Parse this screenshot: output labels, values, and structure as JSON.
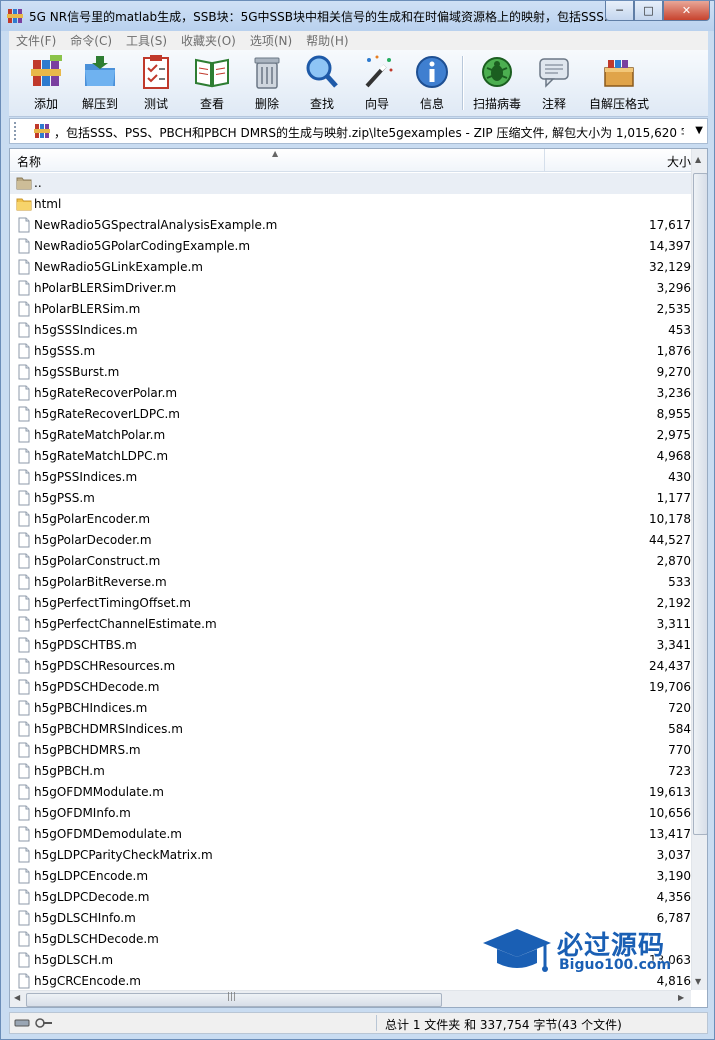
{
  "window": {
    "title": "5G NR信号里的matlab生成，SSB块：5G中SSB块中相关信号的生成和在时偏域资源格上的映射，包括SSS..."
  },
  "menu": [
    "文件(F)",
    "命令(C)",
    "工具(S)",
    "收藏夹(O)",
    "选项(N)",
    "帮助(H)"
  ],
  "toolbar": {
    "items": [
      {
        "label": "添加",
        "icon": "add-archive-icon"
      },
      {
        "label": "解压到",
        "icon": "extract-to-icon"
      },
      {
        "label": "测试",
        "icon": "test-icon"
      },
      {
        "label": "查看",
        "icon": "view-icon"
      },
      {
        "label": "删除",
        "icon": "delete-icon"
      },
      {
        "label": "查找",
        "icon": "find-icon"
      },
      {
        "label": "向导",
        "icon": "wizard-icon"
      },
      {
        "label": "信息",
        "icon": "info-icon"
      },
      {
        "label": "扫描病毒",
        "icon": "virus-scan-icon"
      },
      {
        "label": "注释",
        "icon": "comment-icon"
      },
      {
        "label": "自解压格式",
        "icon": "sfx-icon"
      }
    ]
  },
  "address": {
    "path": "，包括SSS、PSS、PBCH和PBCH DMRS的生成与映射.zip\\lte5gexamples - ZIP 压缩文件, 解包大小为 1,015,620 字节"
  },
  "columns": {
    "name": "名称",
    "size": "大小"
  },
  "files": [
    {
      "name": "..",
      "size": "",
      "type": "parent"
    },
    {
      "name": "html",
      "size": "",
      "type": "folder"
    },
    {
      "name": "NewRadio5GSpectralAnalysisExample.m",
      "size": "17,617",
      "type": "file"
    },
    {
      "name": "NewRadio5GPolarCodingExample.m",
      "size": "14,397",
      "type": "file"
    },
    {
      "name": "NewRadio5GLinkExample.m",
      "size": "32,129",
      "type": "file"
    },
    {
      "name": "hPolarBLERSimDriver.m",
      "size": "3,296",
      "type": "file"
    },
    {
      "name": "hPolarBLERSim.m",
      "size": "2,535",
      "type": "file"
    },
    {
      "name": "h5gSSSIndices.m",
      "size": "453",
      "type": "file"
    },
    {
      "name": "h5gSSS.m",
      "size": "1,876",
      "type": "file"
    },
    {
      "name": "h5gSSBurst.m",
      "size": "9,270",
      "type": "file"
    },
    {
      "name": "h5gRateRecoverPolar.m",
      "size": "3,236",
      "type": "file"
    },
    {
      "name": "h5gRateRecoverLDPC.m",
      "size": "8,955",
      "type": "file"
    },
    {
      "name": "h5gRateMatchPolar.m",
      "size": "2,975",
      "type": "file"
    },
    {
      "name": "h5gRateMatchLDPC.m",
      "size": "4,968",
      "type": "file"
    },
    {
      "name": "h5gPSSIndices.m",
      "size": "430",
      "type": "file"
    },
    {
      "name": "h5gPSS.m",
      "size": "1,177",
      "type": "file"
    },
    {
      "name": "h5gPolarEncoder.m",
      "size": "10,178",
      "type": "file"
    },
    {
      "name": "h5gPolarDecoder.m",
      "size": "44,527",
      "type": "file"
    },
    {
      "name": "h5gPolarConstruct.m",
      "size": "2,870",
      "type": "file"
    },
    {
      "name": "h5gPolarBitReverse.m",
      "size": "533",
      "type": "file"
    },
    {
      "name": "h5gPerfectTimingOffset.m",
      "size": "2,192",
      "type": "file"
    },
    {
      "name": "h5gPerfectChannelEstimate.m",
      "size": "3,311",
      "type": "file"
    },
    {
      "name": "h5gPDSCHTBS.m",
      "size": "3,341",
      "type": "file"
    },
    {
      "name": "h5gPDSCHResources.m",
      "size": "24,437",
      "type": "file"
    },
    {
      "name": "h5gPDSCHDecode.m",
      "size": "19,706",
      "type": "file"
    },
    {
      "name": "h5gPBCHIndices.m",
      "size": "720",
      "type": "file"
    },
    {
      "name": "h5gPBCHDMRSIndices.m",
      "size": "584",
      "type": "file"
    },
    {
      "name": "h5gPBCHDMRS.m",
      "size": "770",
      "type": "file"
    },
    {
      "name": "h5gPBCH.m",
      "size": "723",
      "type": "file"
    },
    {
      "name": "h5gOFDMModulate.m",
      "size": "19,613",
      "type": "file"
    },
    {
      "name": "h5gOFDMInfo.m",
      "size": "10,656",
      "type": "file"
    },
    {
      "name": "h5gOFDMDemodulate.m",
      "size": "13,417",
      "type": "file"
    },
    {
      "name": "h5gLDPCParityCheckMatrix.m",
      "size": "3,037",
      "type": "file"
    },
    {
      "name": "h5gLDPCEncode.m",
      "size": "3,190",
      "type": "file"
    },
    {
      "name": "h5gLDPCDecode.m",
      "size": "4,356",
      "type": "file"
    },
    {
      "name": "h5gDLSCHInfo.m",
      "size": "6,787",
      "type": "file"
    },
    {
      "name": "h5gDLSCHDecode.m",
      "size": "",
      "type": "file"
    },
    {
      "name": "h5gDLSCH.m",
      "size": "13,063",
      "type": "file"
    },
    {
      "name": "h5gCRCEncode.m",
      "size": "4,816",
      "type": "file"
    }
  ],
  "status": {
    "summary": "总计 1 文件夹 和 337,754 字节(43 个文件)"
  },
  "watermark": {
    "text": "必过源码",
    "url": "Biguo100.com"
  },
  "colors": {
    "accent": "#1a5fb4",
    "window_frame": "#c9dcf1",
    "folder": "#f0c24b"
  }
}
